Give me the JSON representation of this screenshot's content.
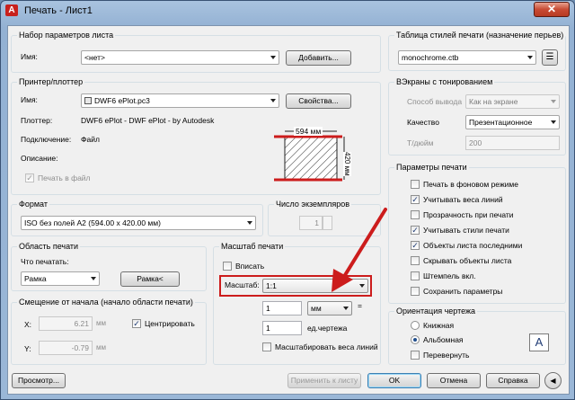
{
  "window": {
    "title": "Печать - Лист1",
    "app_icon": "A",
    "close": "✕"
  },
  "page_setup": {
    "group": "Набор параметров листа",
    "name_label": "Имя:",
    "name_value": "<нет>",
    "add_button": "Добавить..."
  },
  "printer": {
    "group": "Принтер/плоттер",
    "name_label": "Имя:",
    "name_value": "DWF6 ePlot.pc3",
    "props_button": "Свойства...",
    "plotter_label": "Плоттер:",
    "plotter_value": "DWF6 ePlot - DWF ePlot - by Autodesk",
    "connection_label": "Подключение:",
    "connection_value": "Файл",
    "desc_label": "Описание:",
    "print_to_file": "Печать в файл"
  },
  "preview": {
    "width_label": "594 мм",
    "height_label": "420 мм"
  },
  "format": {
    "group": "Формат",
    "value": "ISO без полей A2 (594.00 x 420.00 мм)"
  },
  "copies": {
    "group": "Число экземпляров",
    "value": "1"
  },
  "plot_area": {
    "group": "Область печати",
    "what_label": "Что печатать:",
    "what_value": "Рамка",
    "frame_button": "Рамка<"
  },
  "offset": {
    "group": "Смещение от начала (начало области печати)",
    "x_label": "X:",
    "x_value": "6.21",
    "y_label": "Y:",
    "y_value": "-0.79",
    "unit": "мм",
    "center": "Центрировать"
  },
  "scale": {
    "group": "Масштаб печати",
    "fit": "Вписать",
    "scale_label": "Масштаб:",
    "scale_value": "1:1",
    "val1": "1",
    "unit_value": "мм",
    "eq": "=",
    "val2": "1",
    "unit2": "ед.чертежа",
    "scale_lw": "Масштабировать веса линий"
  },
  "styles": {
    "group": "Таблица стилей печати (назначение перьев)",
    "value": "monochrome.ctb"
  },
  "shaded": {
    "group": "ВЭкраны с тонированием",
    "output_label": "Способ вывода",
    "output_value": "Как на экране",
    "quality_label": "Качество",
    "quality_value": "Презентационное",
    "dpi_label": "Т/дюйм",
    "dpi_value": "200"
  },
  "options": {
    "group": "Параметры печати",
    "items": [
      {
        "label": "Печать в фоновом режиме",
        "checked": false
      },
      {
        "label": "Учитывать веса линий",
        "checked": true
      },
      {
        "label": "Прозрачность при печати",
        "checked": false
      },
      {
        "label": "Учитывать стили печати",
        "checked": true
      },
      {
        "label": "Объекты листа последними",
        "checked": true
      },
      {
        "label": "Скрывать объекты листа",
        "checked": false
      },
      {
        "label": "Штемпель вкл.",
        "checked": false
      },
      {
        "label": "Сохранить параметры",
        "checked": false
      }
    ]
  },
  "orientation": {
    "group": "Ориентация чертежа",
    "portrait": "Книжная",
    "landscape": "Альбомная",
    "flip": "Перевернуть",
    "icon_letter": "A"
  },
  "buttons": {
    "preview": "Просмотр...",
    "apply": "Применить к листу",
    "ok": "OK",
    "cancel": "Отмена",
    "help": "Справка",
    "more": "◀"
  },
  "colors": {
    "highlight": "#cc1c1c",
    "accent": "#1f4d8c"
  }
}
